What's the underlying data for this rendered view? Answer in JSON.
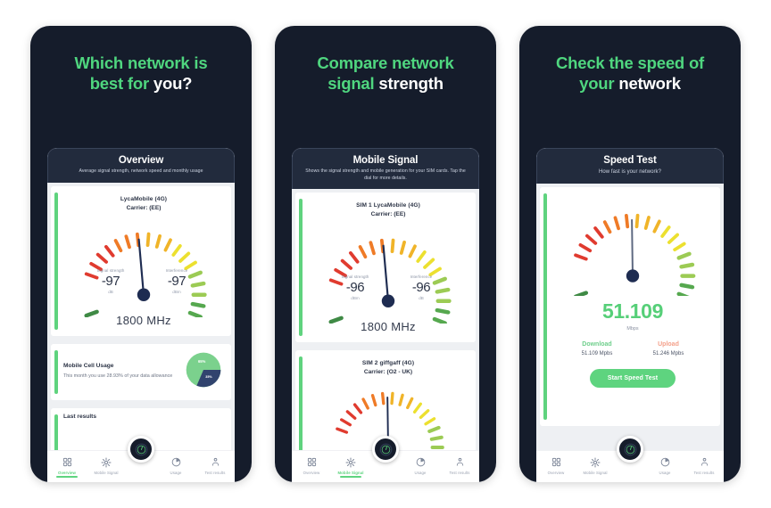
{
  "theme": {
    "page_bg": "#ffffff",
    "phone_bg": "#151c2b",
    "accent_green": "#4fd67f",
    "headline_white": "#ffffff",
    "card_bg": "#ffffff",
    "screen_bg": "#eef0f3",
    "topbar_bg": "#222b3d",
    "gauge_needle": "#1f2d52",
    "upload_color": "#f4a08a",
    "download_color": "#6fcf8c"
  },
  "panels": [
    {
      "id": "overview",
      "headline": {
        "line1_green": "Which network is",
        "line2_green": "best for ",
        "line2_white": "you?"
      },
      "screen": {
        "title": "Overview",
        "subtitle": "Average signal strength, network speed and monthly usage",
        "gauge": {
          "line1": "LycaMobile (4G)",
          "line2": "Carrier: (EE)",
          "left_label": "Signal strength",
          "left_value": "-97",
          "left_unit": "dB",
          "right_label": "Interference",
          "right_value": "-97",
          "right_unit": "dBm",
          "frequency": "1800 MHz"
        },
        "usage": {
          "title": "Mobile Cell Usage",
          "description": "This month you use 28.93% of your data allowance",
          "pie_slice_a_label": "65%",
          "pie_slice_b_label": "35%",
          "pie_slice_a_value": 65,
          "pie_slice_b_value": 35
        },
        "last_results_title": "Last results"
      },
      "tabs": [
        {
          "label": "Overview",
          "icon": "grid-icon",
          "active": true
        },
        {
          "label": "Mobile Signal",
          "icon": "signal-icon",
          "active": false
        },
        {
          "label": "Usage",
          "icon": "pie-clock-icon",
          "active": false
        },
        {
          "label": "Test results",
          "icon": "results-icon",
          "active": false
        }
      ]
    },
    {
      "id": "mobile-signal",
      "headline": {
        "line1_green": "Compare network",
        "line2_green": "signal ",
        "line2_white": "strength"
      },
      "screen": {
        "title": "Mobile Signal",
        "subtitle": "Shows the signal strength and mobile generation for your SIM cards. Tap the dial for more details.",
        "gauge": {
          "line1": "SIM 1 LycaMobile (4G)",
          "line2": "Carrier: (EE)",
          "left_label": "Signal strength",
          "left_value": "-96",
          "left_unit": "dBm",
          "right_label": "Interference",
          "right_value": "-96",
          "right_unit": "dB",
          "frequency": "1800 MHz"
        },
        "gauge2": {
          "line1": "SIM 2 giffgaff (4G)",
          "line2": "Carrier: (O2 - UK)"
        }
      },
      "tabs": [
        {
          "label": "Overview",
          "icon": "grid-icon",
          "active": false
        },
        {
          "label": "Mobile Signal",
          "icon": "signal-icon",
          "active": true
        },
        {
          "label": "Usage",
          "icon": "pie-clock-icon",
          "active": false
        },
        {
          "label": "Test results",
          "icon": "results-icon",
          "active": false
        }
      ]
    },
    {
      "id": "speed-test",
      "headline": {
        "line1_green": "Check the speed of",
        "line2_green": "your ",
        "line2_white": "network"
      },
      "screen": {
        "title": "Speed Test",
        "subtitle": "How fast is your network?",
        "speed": {
          "value": "51.109",
          "unit": "Mbps",
          "download_label": "Download",
          "download_value": "51.109 Mpbs",
          "upload_label": "Upload",
          "upload_value": "51.246 Mpbs",
          "button_label": "Start Speed Test"
        }
      },
      "tabs": [
        {
          "label": "Overview",
          "icon": "grid-icon",
          "active": false
        },
        {
          "label": "Mobile Signal",
          "icon": "signal-icon",
          "active": false
        },
        {
          "label": "Usage",
          "icon": "pie-clock-icon",
          "active": false
        },
        {
          "label": "Test results",
          "icon": "results-icon",
          "active": false
        }
      ]
    }
  ]
}
